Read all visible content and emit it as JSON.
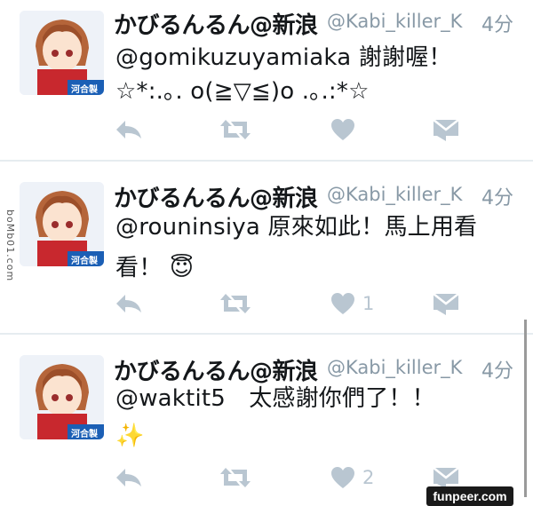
{
  "tweets": [
    {
      "name": "かびるんるん@新浪",
      "handle": "@Kabi_killer_K",
      "time": "4分",
      "avatar_text": "河合製",
      "lines": [
        "@gomikuzuyamiaka 謝謝喔！",
        "☆*:.｡. o(≧▽≦)o .｡.:*☆"
      ],
      "like_count": ""
    },
    {
      "name": "かびるんるん@新浪",
      "handle": "@Kabi_killer_K",
      "time": "4分",
      "avatar_text": "河合製",
      "lines": [
        "@rouninsiya 原來如此！馬上用看",
        "看！ 😇"
      ],
      "like_count": "1"
    },
    {
      "name": "かびるんるん@新浪",
      "handle": "@Kabi_killer_K",
      "time": "4分",
      "avatar_text": "河合製",
      "lines": [
        "@waktit5　太感謝你們了！！",
        "✨"
      ],
      "like_count": "2"
    }
  ],
  "side_watermark": "boMb01.com",
  "watermark": "funpeer.com",
  "colors": {
    "icon": "#b9c6d1",
    "muted": "#8899a6",
    "text": "#14171a",
    "divider": "#e6ecf0"
  },
  "icons": [
    "reply-icon",
    "retweet-icon",
    "heart-icon",
    "message-icon"
  ]
}
